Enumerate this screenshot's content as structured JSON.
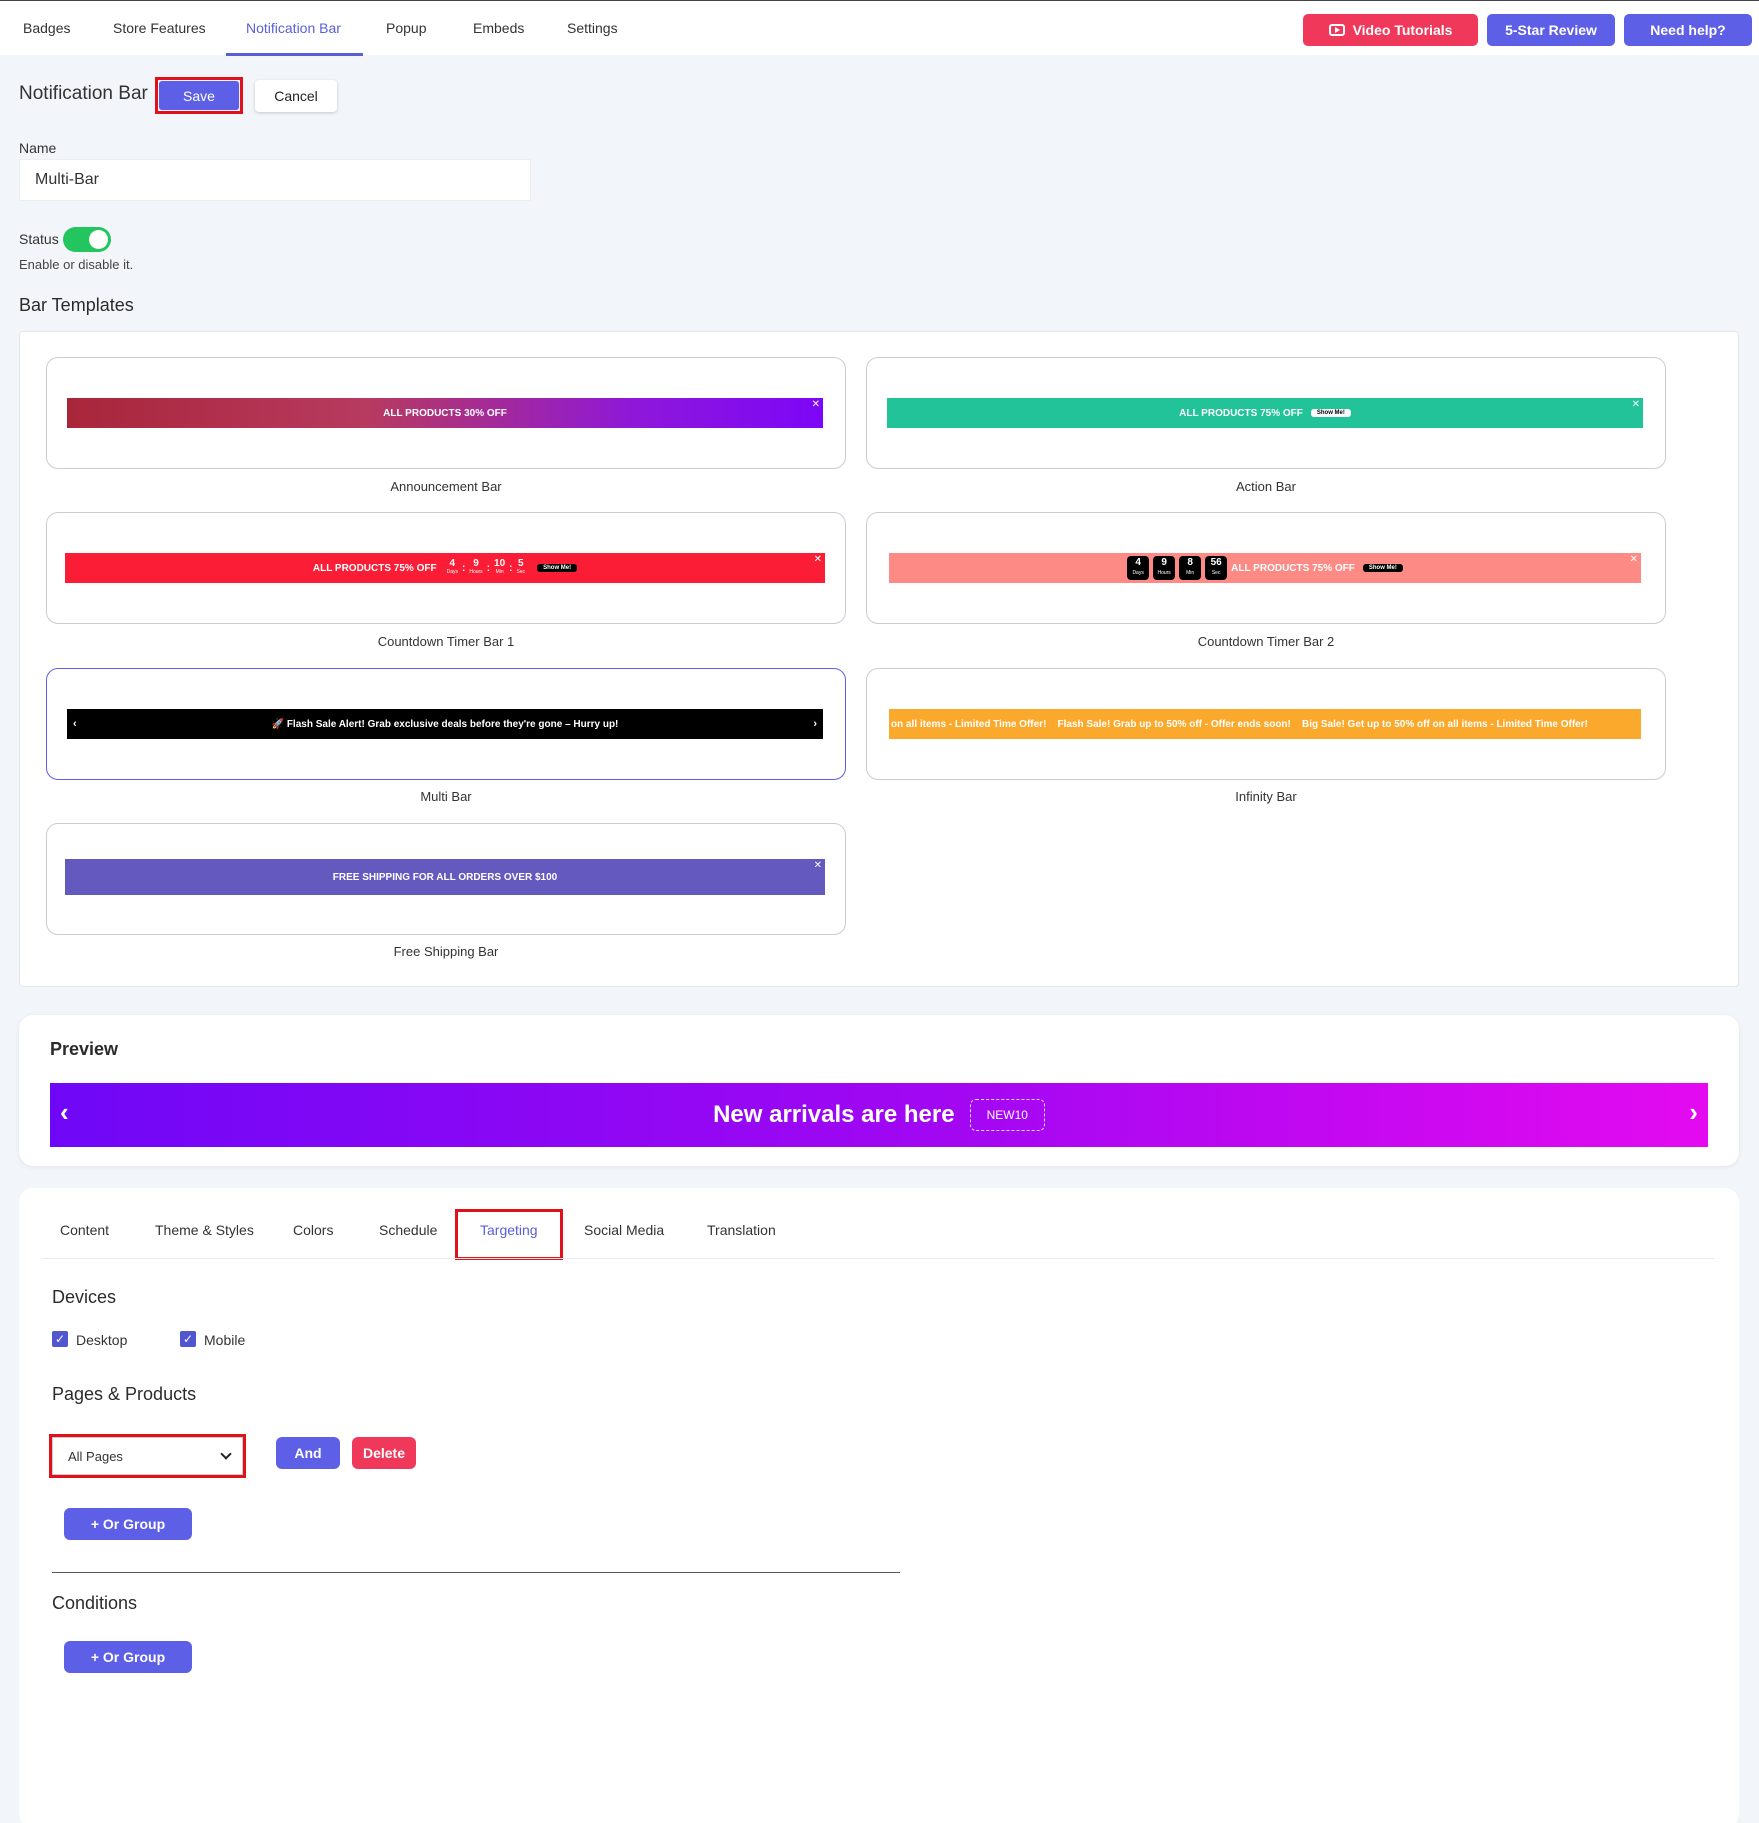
{
  "topnav": {
    "tabs": [
      "Badges",
      "Store Features",
      "Notification Bar",
      "Popup",
      "Embeds",
      "Settings"
    ],
    "active_tab": "Notification Bar",
    "buttons": {
      "video": "Video Tutorials",
      "review": "5-Star Review",
      "help": "Need help?"
    }
  },
  "header": {
    "title": "Notification Bar",
    "save": "Save",
    "cancel": "Cancel"
  },
  "form": {
    "name_label": "Name",
    "name_value": "Multi-Bar",
    "status_label": "Status",
    "status_hint": "Enable or disable it.",
    "status_on": true
  },
  "templates": {
    "title": "Bar Templates",
    "items": [
      {
        "label": "Announcement Bar",
        "text": "ALL PRODUCTS 30% OFF"
      },
      {
        "label": "Action Bar",
        "text": "ALL PRODUCTS 75% OFF",
        "button": "Show Me!"
      },
      {
        "label": "Countdown Timer Bar 1",
        "text": "ALL PRODUCTS 75% OFF",
        "button": "Show Me!",
        "countdown": [
          "4",
          "9",
          "10",
          "5"
        ],
        "units": [
          "Days",
          "Hours",
          "Min",
          "Sec"
        ]
      },
      {
        "label": "Countdown Timer Bar 2",
        "text": "ALL PRODUCTS 75% OFF",
        "button": "Show Me!",
        "countdown": [
          "4",
          "9",
          "8",
          "56"
        ],
        "units": [
          "Days",
          "Hours",
          "Min",
          "Sec"
        ]
      },
      {
        "label": "Multi Bar",
        "text": "🚀 Flash Sale Alert! Grab exclusive deals before they're gone – Hurry up!"
      },
      {
        "label": "Infinity Bar",
        "text": "on all items - Limited Time Offer!    Flash Sale! Grab up to 50% off - Offer ends soon!    Big Sale! Get up to 50% off on all items - Limited Time Offer!"
      },
      {
        "label": "Free Shipping Bar",
        "text": "FREE SHIPPING FOR ALL ORDERS OVER $100"
      }
    ],
    "selected": "Multi Bar"
  },
  "preview": {
    "title": "Preview",
    "text": "New arrivals are here",
    "coupon": "NEW10"
  },
  "settings_tabs": [
    "Content",
    "Theme & Styles",
    "Colors",
    "Schedule",
    "Targeting",
    "Social Media",
    "Translation"
  ],
  "active_settings_tab": "Targeting",
  "targeting": {
    "devices_title": "Devices",
    "desktop": "Desktop",
    "mobile": "Mobile",
    "desktop_checked": true,
    "mobile_checked": true,
    "pages_title": "Pages & Products",
    "pages_select": "All Pages",
    "and_button": "And",
    "delete_button": "Delete",
    "or_group_button": "+ Or Group",
    "conditions_title": "Conditions"
  },
  "colors": {
    "accent": "#5d5fe6",
    "danger": "#f0385a",
    "toggle_on": "#22c55e",
    "highlight_outline": "#e0111a"
  }
}
